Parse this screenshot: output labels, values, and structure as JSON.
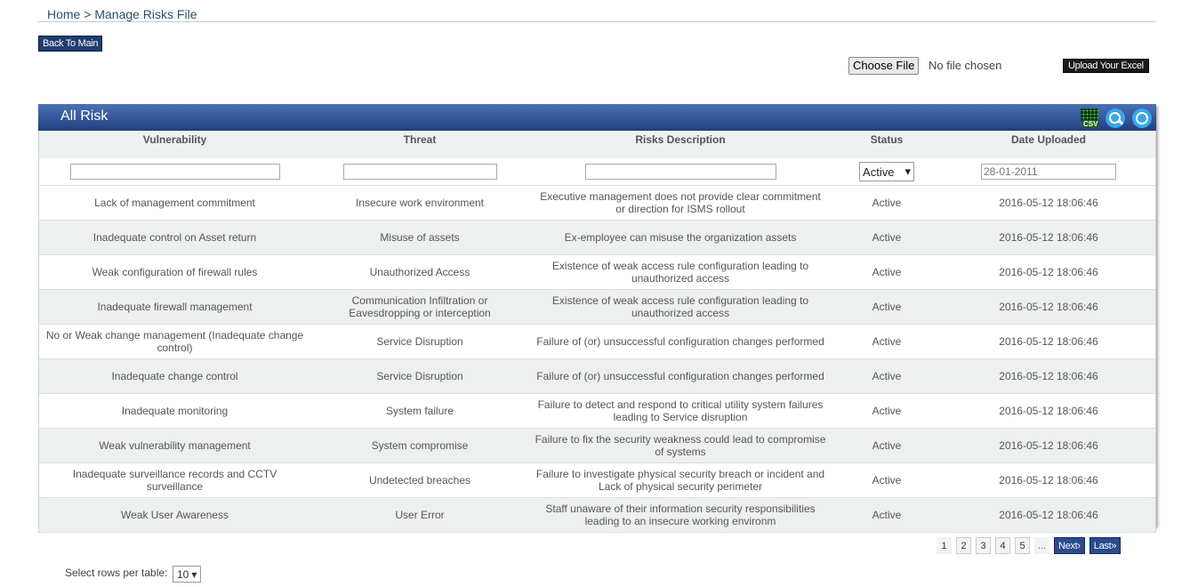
{
  "breadcrumb": {
    "home": "Home",
    "separator": ">",
    "current": "Manage Risks File"
  },
  "toolbar": {
    "back_label": "Back To Main",
    "choose_file_label": "Choose File",
    "file_status": "No file chosen",
    "upload_label": "Upload Your Excel"
  },
  "panel": {
    "title": "All Risk",
    "icons": {
      "csv": "csv-export-icon",
      "search": "search-icon",
      "refresh": "refresh-icon"
    },
    "csv_text": "CSV"
  },
  "table": {
    "columns": [
      "Vulnerability",
      "Threat",
      "Risks Description",
      "Status",
      "Date Uploaded"
    ],
    "filters": {
      "status_selected": "Active",
      "date_placeholder": "28-01-2011"
    },
    "rows": [
      [
        "Lack of management commitment",
        "Insecure work environment",
        "Executive management does not provide clear commitment or direction for ISMS rollout",
        "Active",
        "2016-05-12 18:06:46"
      ],
      [
        "Inadequate control on Asset return",
        "Misuse of assets",
        "Ex-employee can misuse the organization assets",
        "Active",
        "2016-05-12 18:06:46"
      ],
      [
        "Weak configuration of firewall rules",
        "Unauthorized Access",
        "Existence of weak access rule configuration leading to unauthorized access",
        "Active",
        "2016-05-12 18:06:46"
      ],
      [
        "Inadequate firewall management",
        "Communication Infiltration or Eavesdropping or interception",
        "Existence of weak access rule configuration leading to unauthorized access",
        "Active",
        "2016-05-12 18:06:46"
      ],
      [
        "No or Weak change management (Inadequate change control)",
        "Service Disruption",
        "Failure of (or) unsuccessful configuration changes performed",
        "Active",
        "2016-05-12 18:06:46"
      ],
      [
        "Inadequate change control",
        "Service Disruption",
        "Failure of (or) unsuccessful configuration changes performed",
        "Active",
        "2016-05-12 18:06:46"
      ],
      [
        "Inadequate monitoring",
        "System failure",
        "Failure to detect and respond to critical utility system failures leading to Service disruption",
        "Active",
        "2016-05-12 18:06:46"
      ],
      [
        "Weak vulnerability management",
        "System compromise",
        "Failure to fix the security weakness could lead to compromise of systems",
        "Active",
        "2016-05-12 18:06:46"
      ],
      [
        "Inadequate surveillance records and CCTV surveillance",
        "Undetected breaches",
        "Failure to investigate physical security breach or incident and Lack of physical security perimeter",
        "Active",
        "2016-05-12 18:06:46"
      ],
      [
        "Weak User Awareness",
        "User Error",
        "Staff unaware of their information security responsibilities leading to an insecure working environm",
        "Active",
        "2016-05-12 18:06:46"
      ]
    ]
  },
  "pagination": {
    "pages": [
      "1",
      "2",
      "3",
      "4",
      "5"
    ],
    "ellipsis": "...",
    "next_label": "Next›",
    "last_label": "Last»"
  },
  "rows_per_table": {
    "label": "Select rows per table:",
    "value": "10"
  },
  "colors": {
    "header_blue": "#2a4a8a",
    "nav_blue": "#2b4b8c",
    "icon_blue": "#39a7e8"
  }
}
